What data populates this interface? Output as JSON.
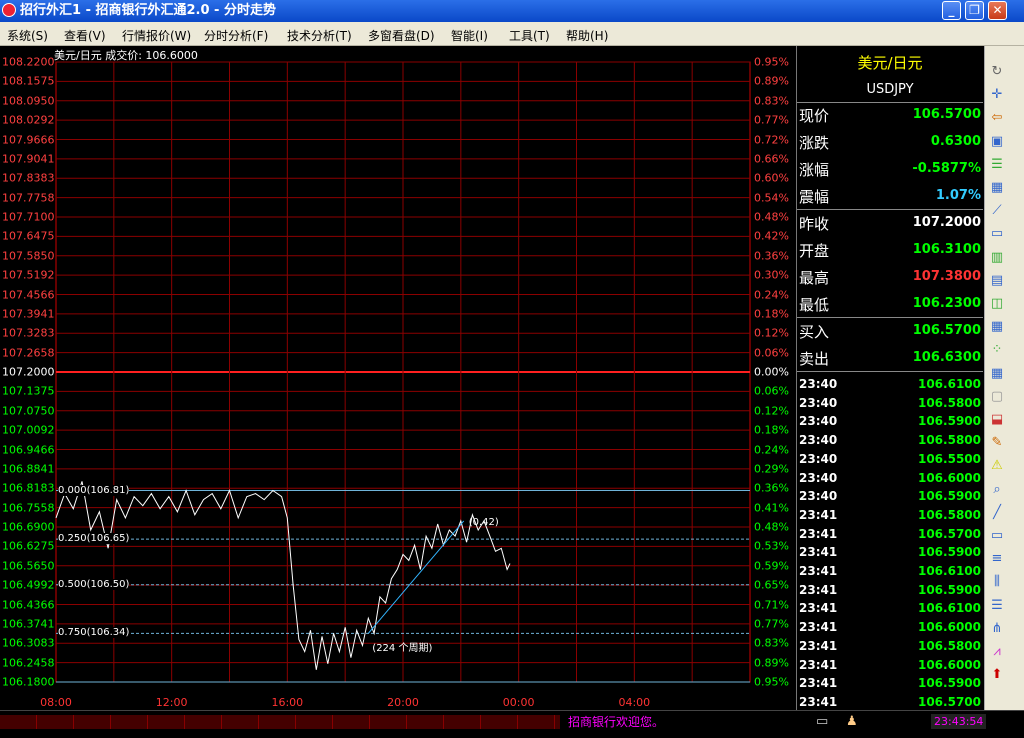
{
  "window": {
    "title": "招行外汇1 - 招商银行外汇通2.0 - 分时走势",
    "min_btn": "_",
    "max_btn": "❐",
    "close_btn": "✕"
  },
  "menu": [
    "系统(S)",
    "查看(V)",
    "行情报价(W)",
    "分时分析(F)",
    "技术分析(T)",
    "多窗看盘(D)",
    "智能(I)",
    "工具(T)",
    "帮助(H)"
  ],
  "chart_data": {
    "type": "line",
    "title": "美元/日元 成交价: 106.6000",
    "symbol": "USDJPY",
    "prev_close": 107.2,
    "x_ticks": [
      "08:00",
      "12:00",
      "16:00",
      "20:00",
      "00:00",
      "04:00"
    ],
    "y_ticks": [
      "108.2200",
      "108.1575",
      "108.0950",
      "108.0292",
      "107.9666",
      "107.9041",
      "107.8383",
      "107.7758",
      "107.7100",
      "107.6475",
      "107.5850",
      "107.5192",
      "107.4566",
      "107.3941",
      "107.3283",
      "107.2658",
      "107.2000",
      "107.1375",
      "107.0750",
      "107.0092",
      "106.9466",
      "106.8841",
      "106.8183",
      "106.7558",
      "106.6900",
      "106.6275",
      "106.5650",
      "106.4992",
      "106.4366",
      "106.3741",
      "106.3083",
      "106.2458",
      "106.1800"
    ],
    "pct_ticks": [
      "0.95%",
      "0.89%",
      "0.83%",
      "0.77%",
      "0.72%",
      "0.66%",
      "0.60%",
      "0.54%",
      "0.48%",
      "0.42%",
      "0.36%",
      "0.30%",
      "0.24%",
      "0.18%",
      "0.12%",
      "0.06%",
      "0.00%",
      "0.06%",
      "0.12%",
      "0.18%",
      "0.24%",
      "0.29%",
      "0.36%",
      "0.41%",
      "0.48%",
      "0.53%",
      "0.59%",
      "0.65%",
      "0.71%",
      "0.77%",
      "0.83%",
      "0.89%",
      "0.95%"
    ],
    "ylim": [
      106.18,
      108.22
    ],
    "xlim_hours": [
      8,
      32
    ],
    "grid": true,
    "series": [
      {
        "x": [
          8.0,
          8.3,
          8.6,
          8.9,
          9.2,
          9.5,
          9.8,
          10.1,
          10.4,
          10.7,
          11.0,
          11.3,
          11.6,
          11.9,
          12.2,
          12.5,
          12.8,
          13.1,
          13.4,
          13.7,
          14.0,
          14.3,
          14.6,
          14.9,
          15.2,
          15.5,
          15.8,
          16.0,
          16.2,
          16.4,
          16.6,
          16.8,
          17.0,
          17.2,
          17.4,
          17.6,
          17.8,
          18.0,
          18.2,
          18.4,
          18.6,
          18.8,
          19.0,
          19.2,
          19.4,
          19.6,
          19.8,
          20.0,
          20.2,
          20.4,
          20.6,
          20.8,
          21.0,
          21.2,
          21.4,
          21.6,
          21.8,
          22.0,
          22.2,
          22.4,
          22.6,
          22.8,
          23.0,
          23.2,
          23.4,
          23.6,
          23.7
        ],
        "y": [
          106.72,
          106.8,
          106.75,
          106.84,
          106.68,
          106.74,
          106.62,
          106.78,
          106.72,
          106.79,
          106.76,
          106.8,
          106.75,
          106.79,
          106.74,
          106.81,
          106.73,
          106.78,
          106.8,
          106.75,
          106.81,
          106.72,
          106.79,
          106.8,
          106.78,
          106.81,
          106.79,
          106.72,
          106.5,
          106.32,
          106.28,
          106.35,
          106.22,
          106.33,
          106.24,
          106.34,
          106.28,
          106.36,
          106.26,
          106.35,
          106.3,
          106.39,
          106.34,
          106.46,
          106.44,
          106.52,
          106.55,
          106.6,
          106.58,
          106.63,
          106.55,
          106.66,
          106.62,
          106.7,
          106.63,
          106.68,
          106.66,
          106.71,
          106.64,
          106.73,
          106.68,
          106.71,
          106.66,
          106.61,
          106.62,
          106.55,
          106.57
        ]
      }
    ],
    "fib_levels": [
      {
        "label": "0.000(106.81)",
        "value": 106.81
      },
      {
        "label": "0.250(106.65)",
        "value": 106.65
      },
      {
        "label": "0.500(106.50)",
        "value": 106.5
      },
      {
        "label": "0.750(106.34)",
        "value": 106.34
      }
    ],
    "trend_line": {
      "start": {
        "x": 18.8,
        "y": 106.34
      },
      "end": {
        "x": 22.1,
        "y": 106.71
      },
      "label_end": "(0.42)",
      "label_start": "(224 个周期)"
    }
  },
  "quote": {
    "title": "美元/日元",
    "code": "USDJPY",
    "rows": [
      {
        "label": "现价",
        "value": "106.5700",
        "color": "#00ff00"
      },
      {
        "label": "涨跌",
        "value": "0.6300",
        "color": "#00ff00"
      },
      {
        "label": "涨幅",
        "value": "-0.5877%",
        "color": "#00ff00"
      },
      {
        "label": "震幅",
        "value": "1.07%",
        "color": "#33ccff"
      },
      {
        "label": "昨收",
        "value": "107.2000",
        "color": "#ffffff"
      },
      {
        "label": "开盘",
        "value": "106.3100",
        "color": "#00ff00"
      },
      {
        "label": "最高",
        "value": "107.3800",
        "color": "#ff3333"
      },
      {
        "label": "最低",
        "value": "106.2300",
        "color": "#00ff00"
      },
      {
        "label": "买入",
        "value": "106.5700",
        "color": "#00ff00"
      },
      {
        "label": "卖出",
        "value": "106.6300",
        "color": "#00ff00"
      }
    ],
    "ticks": [
      {
        "time": "23:40",
        "price": "106.6100"
      },
      {
        "time": "23:40",
        "price": "106.5800"
      },
      {
        "time": "23:40",
        "price": "106.5900"
      },
      {
        "time": "23:40",
        "price": "106.5800"
      },
      {
        "time": "23:40",
        "price": "106.5500"
      },
      {
        "time": "23:40",
        "price": "106.6000"
      },
      {
        "time": "23:40",
        "price": "106.5900"
      },
      {
        "time": "23:41",
        "price": "106.5800"
      },
      {
        "time": "23:41",
        "price": "106.5700"
      },
      {
        "time": "23:41",
        "price": "106.5900"
      },
      {
        "time": "23:41",
        "price": "106.6100"
      },
      {
        "time": "23:41",
        "price": "106.5900"
      },
      {
        "time": "23:41",
        "price": "106.6100"
      },
      {
        "time": "23:41",
        "price": "106.6000"
      },
      {
        "time": "23:41",
        "price": "106.5800"
      },
      {
        "time": "23:41",
        "price": "106.6000"
      },
      {
        "time": "23:41",
        "price": "106.5900"
      },
      {
        "time": "23:41",
        "price": "106.5700"
      }
    ]
  },
  "toolbar_icons": [
    "refresh-icon",
    "crosshair-icon",
    "arrow-left-icon",
    "window-icon",
    "list-icon",
    "table-icon",
    "line-chart-icon",
    "monitor-icon",
    "bar-chart-icon",
    "calculator-icon",
    "chart-window-icon",
    "grid-icon",
    "scatter-icon",
    "calendar-icon",
    "disabled-icon",
    "inbox-icon",
    "pen-icon",
    "warning-icon",
    "zoom-icon",
    "line-draw-icon",
    "rectangle-icon",
    "bars-icon",
    "fib-icon",
    "fib-ret-icon",
    "gann-icon",
    "fan-icon",
    "up-arrow-icon"
  ],
  "status": {
    "message": "招商银行欢迎您。",
    "time": "23:43:54"
  }
}
